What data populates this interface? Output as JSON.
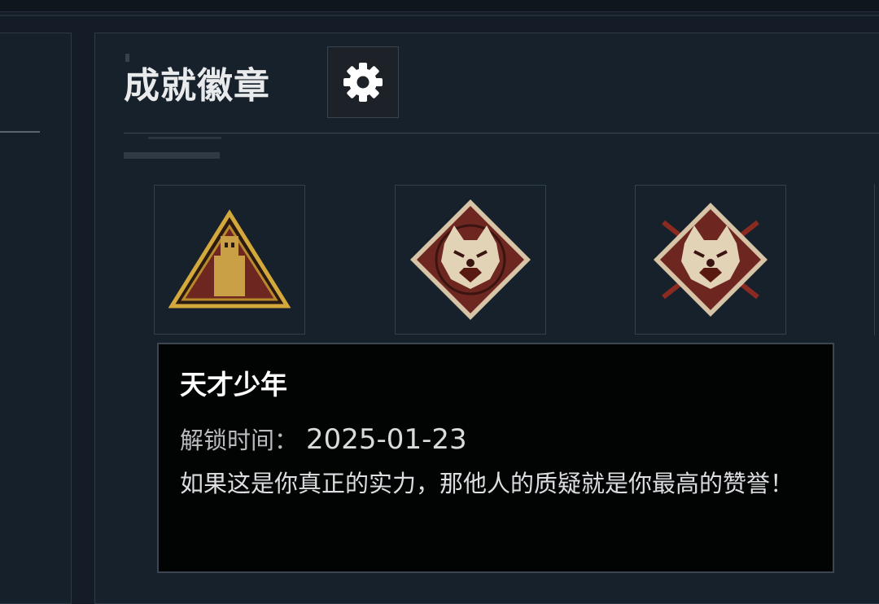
{
  "header": {
    "title": "成就徽章",
    "settings_icon": "gear-icon"
  },
  "badges": [
    {
      "icon": "pyramid-emblem-icon",
      "state": "unlocked"
    },
    {
      "icon": "wolf-diamond-emblem-icon",
      "state": "unlocked"
    },
    {
      "icon": "wolf-diamond-spears-emblem-icon",
      "state": "unlocked"
    }
  ],
  "tooltip": {
    "name": "天才少年",
    "unlock_label": "解锁时间：",
    "unlock_date": "2025-01-23",
    "description": "如果这是你真正的实力，那他人的质疑就是你最高的赞誉！"
  },
  "colors": {
    "background": "#141d27",
    "panel": "#17212b",
    "badge_gold": "#d3a93c",
    "badge_red": "#7a2a22",
    "tooltip_bg": "#020303"
  }
}
